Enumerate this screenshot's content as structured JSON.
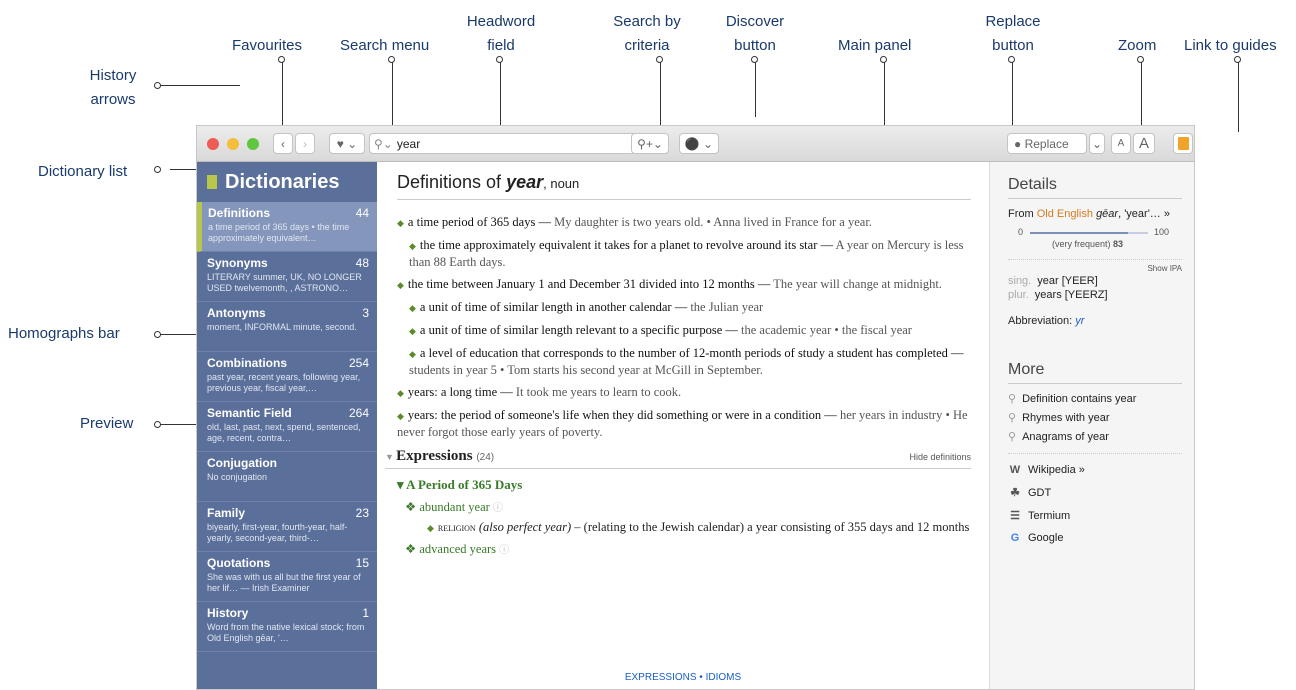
{
  "callouts": {
    "history_arrows": "History\narrows",
    "favourites": "Favourites",
    "search_menu": "Search menu",
    "headword_field": "Headword\nfield",
    "search_by_criteria": "Search by\ncriteria",
    "discover_button": "Discover\nbutton",
    "main_panel": "Main panel",
    "replace_button": "Replace\nbutton",
    "zoom": "Zoom",
    "link_to_guides": "Link to guides",
    "dictionary_list": "Dictionary list",
    "homographs_bar": "Homographs bar",
    "preview": "Preview"
  },
  "toolbar": {
    "search_value": "year",
    "replace_label": "Replace",
    "zoom_small": "A",
    "zoom_large": "A"
  },
  "sidebar": {
    "title": "Dictionaries",
    "items": [
      {
        "title": "Definitions",
        "count": "44",
        "preview": "a time period of 365 days • the time approximately equivalent…"
      },
      {
        "title": "Synonyms",
        "count": "48",
        "preview": "LITERARY summer, UK, NO LONGER USED twelvemonth, , ASTRONO…"
      },
      {
        "title": "Antonyms",
        "count": "3",
        "preview": "moment, INFORMAL minute, second."
      },
      {
        "title": "Combinations",
        "count": "254",
        "preview": "past year, recent years, following year, previous year, fiscal year,…"
      },
      {
        "title": "Semantic Field",
        "count": "264",
        "preview": "old, last, past, next, spend, sentenced, age, recent, contra…"
      },
      {
        "title": "Conjugation",
        "count": "",
        "preview": "No conjugation"
      },
      {
        "title": "Family",
        "count": "23",
        "preview": "biyearly, first-year, fourth-year, half-yearly, second-year, third-…"
      },
      {
        "title": "Quotations",
        "count": "15",
        "preview": "She was with us all but the first year of her lif… — Irish Examiner"
      },
      {
        "title": "History",
        "count": "1",
        "preview": "Word from the native lexical stock; from Old English gēar, '…"
      }
    ]
  },
  "main": {
    "heading_prefix": "Definitions of ",
    "heading_word": "year",
    "heading_pos": ", noun",
    "definitions": [
      {
        "sub": false,
        "def": "a time period of 365 days — ",
        "ex": "My daughter is two years old. • Anna lived in France for a year."
      },
      {
        "sub": true,
        "def": "the time approximately equivalent it takes for a planet to revolve around its star — ",
        "ex": "A year on Mercury is less than 88 Earth days."
      },
      {
        "sub": false,
        "def": "the time between January 1 and December 31 divided into 12 months — ",
        "ex": "The year will change at midnight."
      },
      {
        "sub": true,
        "def": "a unit of time of similar length in another calendar — ",
        "ex": "the Julian year"
      },
      {
        "sub": true,
        "def": "a unit of time of similar length relevant to a specific purpose — ",
        "ex": "the academic year • the fiscal year"
      },
      {
        "sub": true,
        "def": "a level of education that corresponds to the number of 12-month periods of study a student has completed — ",
        "ex": "students in year 5 • Tom starts his second year at McGill in September."
      },
      {
        "sub": false,
        "def": "years: a long time — ",
        "ex": "It took me years to learn to cook."
      },
      {
        "sub": false,
        "def": "years: the period of someone's life when they did something or were in a condition — ",
        "ex": "her years in industry • He never forgot those early years of poverty."
      }
    ],
    "expressions_title": "Expressions",
    "expressions_count": "(24)",
    "hide_definitions": "Hide definitions",
    "period_heading": "A Period of 365 Days",
    "expr1": "abundant year",
    "expr1_tag": "RELIGION",
    "expr1_also": "(also perfect year)",
    "expr1_def": "– (relating to the Jewish calendar) a year consisting of 355 days and 12 months",
    "expr2": "advanced years",
    "footer_links": "EXPRESSIONS • IDIOMS"
  },
  "details": {
    "title": "Details",
    "from_prefix": "From ",
    "from_lang": "Old English",
    "from_word": "gēar",
    "from_suffix": ", 'year'… »",
    "freq_min": "0",
    "freq_max": "100",
    "freq_label": "(very frequent)",
    "freq_value": "83",
    "show_ipa": "Show IPA",
    "sing_label": "sing.",
    "sing_value": "year [YEER]",
    "plur_label": "plur.",
    "plur_value": "years [YEERZ]",
    "abbrev_label": "Abbreviation:",
    "abbrev_value": "yr",
    "more_title": "More",
    "more_items": [
      "Definition contains year",
      "Rhymes with year",
      "Anagrams of year"
    ],
    "links": [
      "Wikipedia »",
      "GDT",
      "Termium",
      "Google"
    ]
  },
  "colors": {
    "sidebar": "#5a6f9a",
    "accent": "#b8c64a",
    "origin": "#d87a1e",
    "link": "#1a5ec8"
  }
}
